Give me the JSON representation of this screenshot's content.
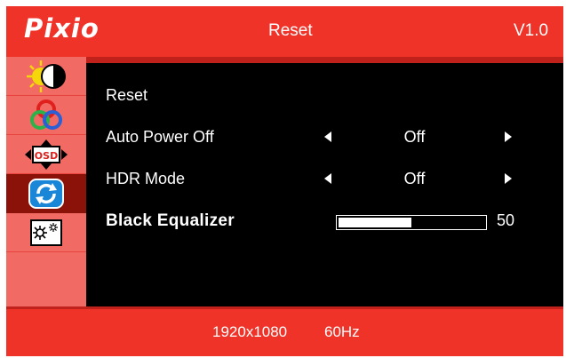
{
  "header": {
    "logo": "Pixio",
    "title": "Reset",
    "version": "V1.0"
  },
  "sidebar": {
    "items": [
      {
        "icon": "brightness-contrast-icon",
        "active": false
      },
      {
        "icon": "color-icon",
        "active": false
      },
      {
        "icon": "osd-icon",
        "active": false
      },
      {
        "icon": "reset-icon",
        "active": true
      },
      {
        "icon": "settings-icon",
        "active": false
      }
    ]
  },
  "menu": {
    "rows": [
      {
        "label": "Reset"
      },
      {
        "label": "Auto Power Off",
        "value": "Off"
      },
      {
        "label": "HDR Mode",
        "value": "Off"
      },
      {
        "label": "Black Equalizer",
        "value": "50",
        "max": 100
      }
    ]
  },
  "footer": {
    "resolution": "1920x1080",
    "refresh": "60Hz"
  },
  "colors": {
    "frame": "#ef3329",
    "sidebar": "#f26a64",
    "active": "#8a1208",
    "panel": "#000000"
  }
}
